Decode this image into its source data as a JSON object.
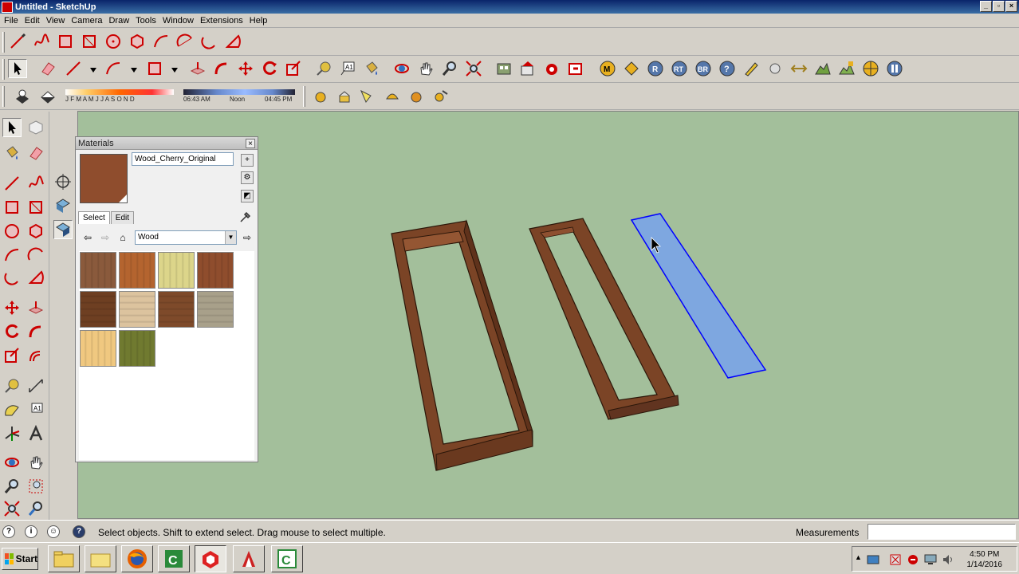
{
  "window": {
    "title": "Untitled - SketchUp"
  },
  "menu": [
    "File",
    "Edit",
    "View",
    "Camera",
    "Draw",
    "Tools",
    "Window",
    "Extensions",
    "Help"
  ],
  "shadows": {
    "months": "J F M A M J J A S O N D",
    "time_start": "06:43 AM",
    "time_noon": "Noon",
    "time_end": "04:45 PM"
  },
  "materials": {
    "title": "Materials",
    "current_name": "Wood_Cherry_Original",
    "current_color": "#8f4d2d",
    "tabs": [
      "Select",
      "Edit"
    ],
    "selected_tab": "Select",
    "library": "Wood",
    "swatches": [
      {
        "color": "#8a5a3c"
      },
      {
        "color": "#b4642f"
      },
      {
        "color": "#dcd58a"
      },
      {
        "color": "#8f4d2d"
      },
      {
        "color": "#6e3f22"
      },
      {
        "color": "#dcc39e"
      },
      {
        "color": "#7e4a2a"
      },
      {
        "color": "#a8a08a"
      },
      {
        "color": "#f0c880"
      },
      {
        "color": "#707a30"
      }
    ]
  },
  "status": {
    "hint": "Select objects. Shift to extend select. Drag mouse to select multiple.",
    "measurements_label": "Measurements",
    "measurements_value": ""
  },
  "taskbar": {
    "start_label": "Start",
    "time": "4:50 PM",
    "date": "1/14/2016"
  },
  "colors": {
    "viewport_bg": "#a3bf9b",
    "selection_blue": "#0000ff",
    "selection_fill": "#7ea7e0"
  }
}
